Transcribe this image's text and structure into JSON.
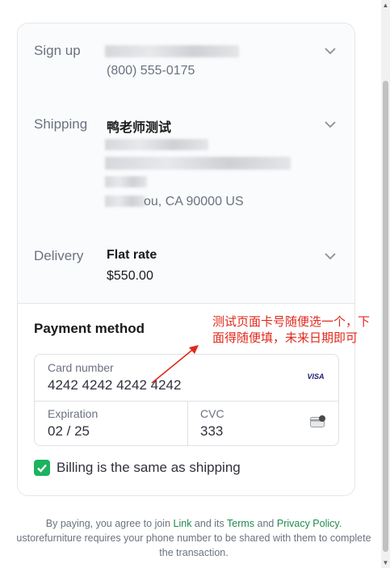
{
  "signup": {
    "label": "Sign up",
    "phone": "(800) 555-0175"
  },
  "shipping": {
    "label": "Shipping",
    "name": "鸭老师测试",
    "address_last": "ou, CA 90000 US"
  },
  "delivery": {
    "label": "Delivery",
    "method": "Flat rate",
    "price": "$550.00"
  },
  "payment": {
    "title": "Payment method",
    "card_number_label": "Card number",
    "card_number": "4242 4242 4242 4242",
    "card_brand": "VISA",
    "expiration_label": "Expiration",
    "expiration": "02 / 25",
    "cvc_label": "CVC",
    "cvc": "333",
    "billing_same": "Billing is the same as shipping"
  },
  "annotation": {
    "text": "测试页面卡号随便选一个，下面得随便填，未来日期即可"
  },
  "footer": {
    "text1": "By paying, you agree to join ",
    "link": "Link",
    "text2": " and its ",
    "terms": "Terms",
    "text3": " and ",
    "privacy": "Privacy Policy",
    "text4": ".",
    "line2": "ustorefurniture requires your phone number to be shared with them to complete the transaction."
  },
  "colors": {
    "accent_green": "#1bb35f",
    "annotation_red": "#e02a1d",
    "link_green": "#1f8a4c"
  }
}
